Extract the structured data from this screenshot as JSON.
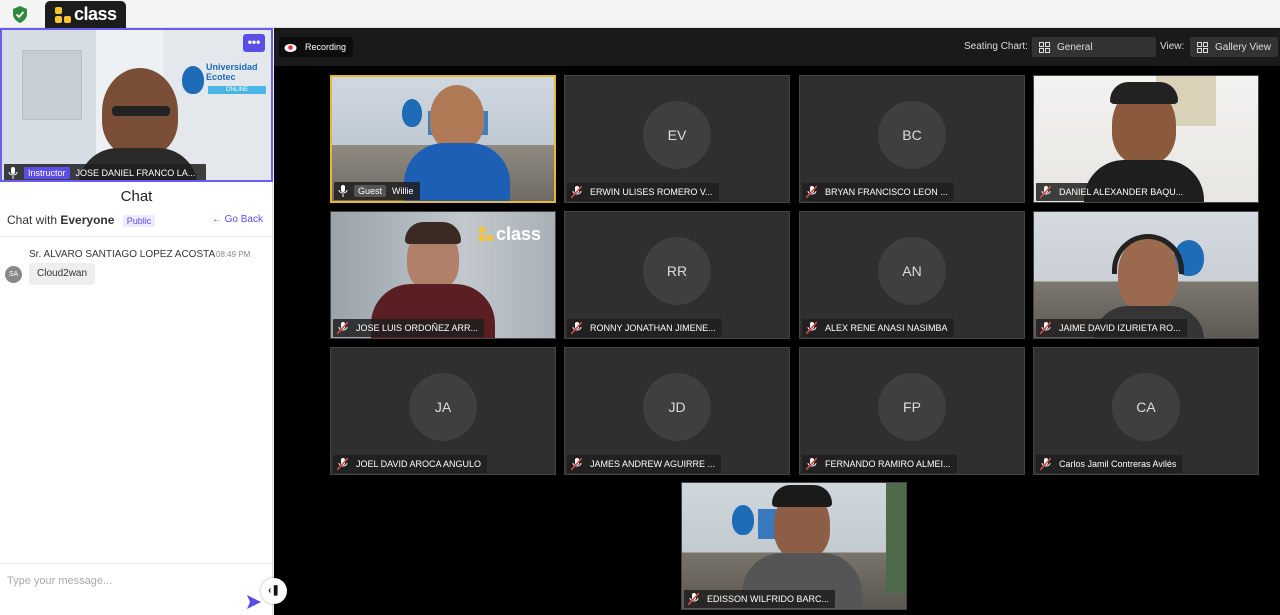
{
  "app": {
    "logo_text": "class"
  },
  "self_view": {
    "role": "Instructor",
    "name": "JOSE DANIEL FRANCO LA...",
    "more": "•••"
  },
  "chat": {
    "title": "Chat",
    "with_prefix": "Chat with",
    "with_target": "Everyone",
    "visibility": "Public",
    "go_back": "Go Back",
    "messages": [
      {
        "avatar": "SA",
        "sender": "Sr. ALVARO SANTIAGO LOPEZ ACOSTA",
        "time": "08:49 PM",
        "text": "Cloud2wan"
      }
    ],
    "input_placeholder": "Type your message..."
  },
  "toolbar": {
    "recording": "Recording",
    "seating_label": "Seating Chart:",
    "seating_value": "General",
    "view_label": "View:",
    "view_value": "Gallery View"
  },
  "participants": [
    {
      "name": "Willie",
      "role": "Guest",
      "video": true,
      "speaking": true
    },
    {
      "name": "ERWIN ULISES ROMERO V...",
      "initials": "EV"
    },
    {
      "name": "BRYAN FRANCISCO LEON ...",
      "initials": "BC"
    },
    {
      "name": "DANIEL ALEXANDER BAQU...",
      "video": true
    },
    {
      "name": "JOSE LUIS ORDOÑEZ ARR...",
      "video": true
    },
    {
      "name": "RONNY JONATHAN JIMENE...",
      "initials": "RR"
    },
    {
      "name": "ALEX RENE ANASI NASIMBA",
      "initials": "AN"
    },
    {
      "name": "JAIME DAVID IZURIETA RO...",
      "video": true
    },
    {
      "name": "JOEL DAVID AROCA ANGULO",
      "initials": "JA"
    },
    {
      "name": "JAMES ANDREW AGUIRRE ...",
      "initials": "JD"
    },
    {
      "name": "FERNANDO RAMIRO ALMEI...",
      "initials": "FP"
    },
    {
      "name": "Carlos Jamil Contreras Avilés",
      "initials": "CA"
    },
    {
      "name": "EDISSON WILFRIDO BARC...",
      "video": true
    }
  ],
  "video_overlays": {
    "class_watermark": "class",
    "ecotec_brand": "Universidad Ecotec",
    "ecotec_sub": "ONLINE"
  },
  "colors": {
    "accent": "#5b4ee8",
    "speaking": "#e8b734",
    "stage_bg": "#000000",
    "tile_bg": "#2f2f2f",
    "mute_red": "#e04848"
  }
}
